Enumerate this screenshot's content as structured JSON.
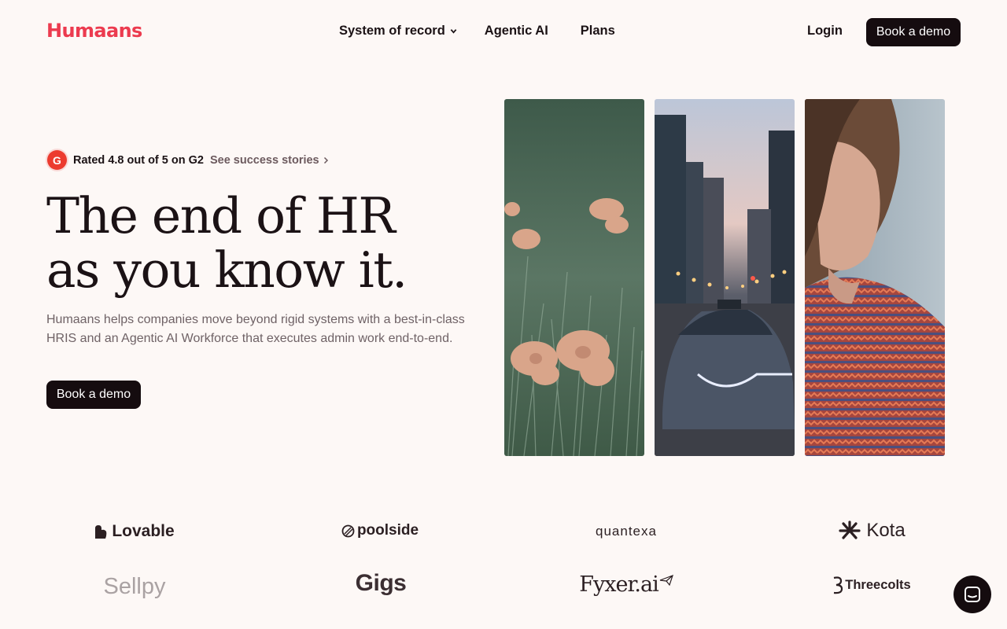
{
  "header": {
    "logo": "Humaans",
    "nav": [
      "System of record",
      "Agentic AI",
      "Plans"
    ],
    "login": "Login",
    "cta": "Book a demo"
  },
  "hero": {
    "g2_badge": "G",
    "rating": "Rated 4.8 out of 5 on G2",
    "stories_link": "See success stories",
    "title_line1": "The end of HR",
    "title_line2": "as you know it.",
    "subtitle": "Humaans helps companies move beyond rigid systems with a best-in-class HRIS and an Agentic AI Workforce that executes admin work end-to-end.",
    "cta": "Book a demo"
  },
  "images": [
    "flowers",
    "city-car",
    "woman-portrait"
  ],
  "logos": [
    "Lovable",
    "poolside",
    "quantexa",
    "Kota",
    "Sellpy",
    "Gigs",
    "Fyxer.ai",
    "Threecolts"
  ],
  "colors": {
    "brand": "#ec3b4f",
    "dark": "#150c0f",
    "background": "#fdf8f6"
  }
}
